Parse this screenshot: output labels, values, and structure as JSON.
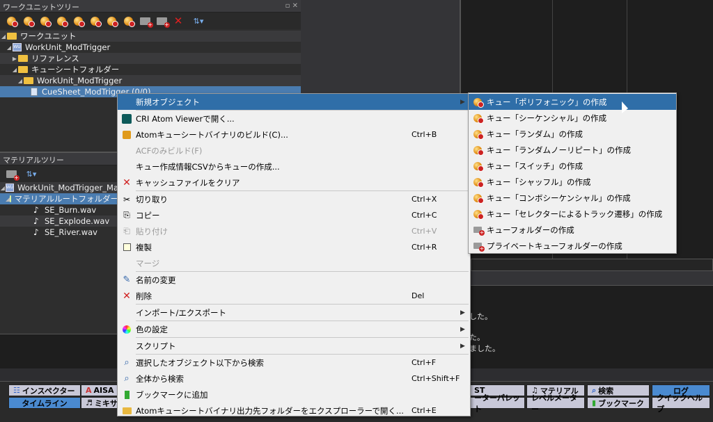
{
  "workunit_panel": {
    "title": "ワークユニットツリー",
    "tree": {
      "root": "ワークユニット",
      "wu": "WorkUnit_ModTrigger",
      "ref": "リファレンス",
      "csf": "キューシートフォルダー",
      "csf_wu": "WorkUnit_ModTrigger",
      "cs": "CueSheet_ModTrigger (0/0)"
    }
  },
  "material_panel": {
    "title": "マテリアルツリー",
    "tree": {
      "wu": "WorkUnit_ModTrigger_Ma",
      "root": "マテリアルルートフォルダー",
      "files": [
        "SE_Burn.wav",
        "SE_Explode.wav",
        "SE_River.wav"
      ]
    }
  },
  "context_menu": {
    "items": [
      {
        "label": "新規オブジェクト",
        "shortcut": "",
        "sub": "▶",
        "state": "hi",
        "icon": ""
      },
      {
        "label": "CRI Atom Viewerで開く...",
        "shortcut": "",
        "sub": "",
        "state": "",
        "icon": "viewer-icon"
      },
      {
        "label": "Atomキューシートバイナリのビルド(C)...",
        "shortcut": "Ctrl+B",
        "sub": "",
        "state": "",
        "icon": "build-icon"
      },
      {
        "label": "ACFのみビルド(F)",
        "shortcut": "",
        "sub": "",
        "state": "dis",
        "icon": ""
      },
      {
        "label": "キュー作成情報CSVからキューの作成...",
        "shortcut": "",
        "sub": "",
        "state": "",
        "icon": ""
      },
      {
        "label": "キャッシュファイルをクリア",
        "shortcut": "",
        "sub": "",
        "state": "",
        "icon": "delete-icon"
      },
      {
        "label": "切り取り",
        "shortcut": "Ctrl+X",
        "sub": "",
        "state": "",
        "icon": "cut-icon"
      },
      {
        "label": "コピー",
        "shortcut": "Ctrl+C",
        "sub": "",
        "state": "",
        "icon": "copy-icon"
      },
      {
        "label": "貼り付け",
        "shortcut": "Ctrl+V",
        "sub": "",
        "state": "dis",
        "icon": "paste-icon"
      },
      {
        "label": "複製",
        "shortcut": "Ctrl+R",
        "sub": "",
        "state": "",
        "icon": "duplicate-icon"
      },
      {
        "label": "マージ",
        "shortcut": "",
        "sub": "",
        "state": "dis",
        "icon": ""
      },
      {
        "label": "名前の変更",
        "shortcut": "",
        "sub": "",
        "state": "",
        "icon": "pencil-icon"
      },
      {
        "label": "削除",
        "shortcut": "Del",
        "sub": "",
        "state": "",
        "icon": "delete-icon"
      },
      {
        "label": "インポート/エクスポート",
        "shortcut": "",
        "sub": "▶",
        "state": "",
        "icon": ""
      },
      {
        "label": "色の設定",
        "shortcut": "",
        "sub": "▶",
        "state": "",
        "icon": "color-icon"
      },
      {
        "label": "スクリプト",
        "shortcut": "",
        "sub": "▶",
        "state": "",
        "icon": ""
      },
      {
        "label": "選択したオブジェクト以下から検索",
        "shortcut": "Ctrl+F",
        "sub": "",
        "state": "",
        "icon": "search-icon"
      },
      {
        "label": "全体から検索",
        "shortcut": "Ctrl+Shift+F",
        "sub": "",
        "state": "",
        "icon": "search-icon"
      },
      {
        "label": "ブックマークに追加",
        "shortcut": "",
        "sub": "",
        "state": "",
        "icon": "bookmark-icon"
      },
      {
        "label": "Atomキューシートバイナリ出力先フォルダーをエクスプローラーで開く...",
        "shortcut": "Ctrl+E",
        "sub": "",
        "state": "",
        "icon": "folder-icon"
      }
    ]
  },
  "submenu": {
    "items": [
      "キュー「ポリフォニック」の作成",
      "キュー「シーケンシャル」の作成",
      "キュー「ランダム」の作成",
      "キュー「ランダムノーリピート」の作成",
      "キュー「スイッチ」の作成",
      "キュー「シャッフル」の作成",
      "キュー「コンボシーケンシャル」の作成",
      "キュー「セレクターによるトラック遷移」の作成",
      "キューフォルダーの作成",
      "プライベートキューフォルダーの作成"
    ]
  },
  "log": {
    "lines": [
      "した。",
      "た。",
      "ました。"
    ]
  },
  "bottom_tabs": {
    "row1": [
      "インスペクター",
      "AISA",
      "ST",
      "マテリアル",
      "検索",
      "ログ"
    ],
    "row2": [
      "タイムライン",
      "ミキサ",
      "ーターパレット",
      "レベルメーター",
      "ブックマーク",
      "クイックヘルプ"
    ]
  }
}
